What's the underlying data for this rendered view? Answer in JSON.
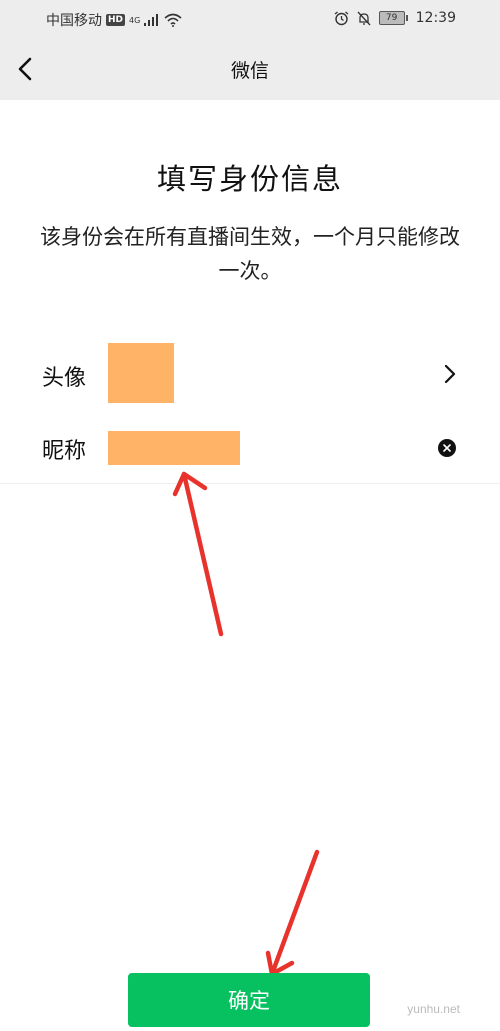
{
  "status_bar": {
    "carrier": "中国移动",
    "hd_badge": "HD",
    "network": "4G",
    "battery": "79",
    "time": "12:39",
    "icons": [
      "signal-icon",
      "wifi-icon",
      "alarm-icon",
      "mute-icon",
      "battery-icon"
    ]
  },
  "nav": {
    "title": "微信",
    "back_icon": "chevron-left-icon"
  },
  "page": {
    "heading": "填写身份信息",
    "description": "该身份会在所有直播间生效，一个月只能修改一次。"
  },
  "form": {
    "avatar_label": "头像",
    "nickname_label": "昵称",
    "nickname_value": "",
    "avatar_chevron_icon": "chevron-right-icon",
    "clear_icon": "clear-icon"
  },
  "confirm_label": "确定",
  "watermark": "yunhu.net",
  "colors": {
    "primary_green": "#07c160",
    "placeholder_orange": "#ffb366",
    "annotation_red": "#e8332d",
    "header_bg": "#ededed"
  }
}
